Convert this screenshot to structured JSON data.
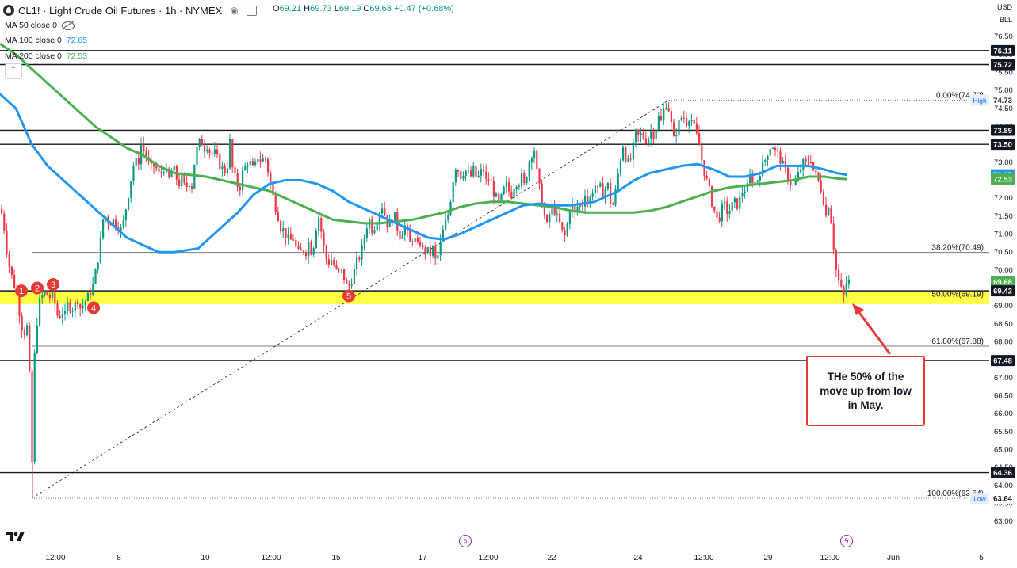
{
  "header": {
    "symbol_title": "CL1! · Light Crude Oil Futures · 1h · NYMEX",
    "open_label": "O",
    "open": "69.21",
    "high_label": "H",
    "high": "69.73",
    "low_label": "L",
    "low": "69.19",
    "close_label": "C",
    "close": "69.68",
    "change": "+0.47 (+0.68%)"
  },
  "indicators": [
    {
      "label": "MA 50 close 0",
      "value": "",
      "color": "#131722"
    },
    {
      "label": "MA 100 close 0",
      "value": "72.65",
      "color": "#2196f3"
    },
    {
      "label": "MA 200 close 0",
      "value": "72.53",
      "color": "#4caf50"
    }
  ],
  "top_right": {
    "currency": "USD",
    "unit": "BLL"
  },
  "annotation": {
    "text": "THe 50% of the move up from low in May."
  },
  "events": [
    {
      "icon": "forward-icon"
    },
    {
      "icon": "bolt-icon"
    }
  ],
  "colors": {
    "up": "#089981",
    "down": "#f23645",
    "ma100": "#2196f3",
    "ma200": "#4caf50",
    "highlight": "#ffff3b",
    "marker": "#e53935",
    "arrow": "#e53935"
  },
  "chart_data": {
    "type": "candlestick",
    "ylim": [
      62.6,
      77.4
    ],
    "y_ticks": [
      63.0,
      63.5,
      64.0,
      64.5,
      65.0,
      65.5,
      66.0,
      66.5,
      67.0,
      67.5,
      68.0,
      68.5,
      69.0,
      69.5,
      70.0,
      70.5,
      71.0,
      71.5,
      72.0,
      72.5,
      73.0,
      73.5,
      74.0,
      74.5,
      75.0,
      75.5,
      76.0,
      76.5
    ],
    "x_tick_labels": [
      "12:00",
      "8",
      "10",
      "12:00",
      "15",
      "17",
      "12:00",
      "22",
      "24",
      "12:00",
      "29",
      "12:00",
      "Jun",
      "5"
    ],
    "price_badges": [
      {
        "value": "76.11",
        "style": "black"
      },
      {
        "value": "75.72",
        "style": "black"
      },
      {
        "value": "74.73",
        "style": "gray",
        "tag": "High"
      },
      {
        "value": "73.89",
        "style": "black"
      },
      {
        "value": "73.50",
        "style": "black"
      },
      {
        "value": "72.65",
        "style": "blue"
      },
      {
        "value": "72.53",
        "style": "green"
      },
      {
        "value": "69.68",
        "style": "greenlast"
      },
      {
        "value": "69.42",
        "style": "black"
      },
      {
        "value": "67.48",
        "style": "black"
      },
      {
        "value": "64.36",
        "style": "black"
      },
      {
        "value": "63.64",
        "style": "gray",
        "tag": "Low"
      }
    ],
    "horizontal_lines": [
      76.11,
      75.72,
      73.89,
      73.5,
      69.42,
      67.48,
      64.36
    ],
    "fib_levels": [
      {
        "label": "0.00%(74.73)",
        "value": 74.73
      },
      {
        "label": "38.20%(70.49)",
        "value": 70.49
      },
      {
        "label": "50.00%(69.19)",
        "value": 69.19
      },
      {
        "label": "61.80%(67.88)",
        "value": 67.88
      },
      {
        "label": "100.00%(63.64)",
        "value": 63.64
      }
    ],
    "highlight_zone": [
      69.14,
      69.42
    ],
    "markers": [
      "1",
      "2",
      "3",
      "4",
      "5"
    ],
    "price_path": [
      [
        0,
        71.7
      ],
      [
        4,
        71.6
      ],
      [
        8,
        71.1
      ],
      [
        12,
        70.3
      ],
      [
        16,
        69.9
      ],
      [
        20,
        69.6
      ],
      [
        24,
        69.3
      ],
      [
        28,
        68.6
      ],
      [
        32,
        68.2
      ],
      [
        36,
        68.5
      ],
      [
        40,
        66.8
      ],
      [
        42,
        63.64
      ],
      [
        44,
        67.0
      ],
      [
        48,
        68.4
      ],
      [
        52,
        69.1
      ],
      [
        56,
        69.3
      ],
      [
        60,
        69.4
      ],
      [
        64,
        69.2
      ],
      [
        68,
        69.4
      ],
      [
        72,
        69.0
      ],
      [
        76,
        68.6
      ],
      [
        80,
        68.9
      ],
      [
        84,
        68.7
      ],
      [
        88,
        69.1
      ],
      [
        92,
        68.9
      ],
      [
        96,
        69.0
      ],
      [
        100,
        69.2
      ],
      [
        104,
        68.9
      ],
      [
        108,
        69.1
      ],
      [
        112,
        69.2
      ],
      [
        116,
        69.4
      ],
      [
        120,
        69.6
      ],
      [
        124,
        70.1
      ],
      [
        128,
        70.6
      ],
      [
        132,
        71.4
      ],
      [
        136,
        71.5
      ],
      [
        140,
        71.3
      ],
      [
        144,
        71.4
      ],
      [
        148,
        71.3
      ],
      [
        152,
        71.2
      ],
      [
        156,
        71.1
      ],
      [
        160,
        71.6
      ],
      [
        164,
        72.1
      ],
      [
        168,
        72.6
      ],
      [
        172,
        73.1
      ],
      [
        176,
        72.9
      ],
      [
        180,
        73.5
      ],
      [
        184,
        73.3
      ],
      [
        188,
        73.1
      ],
      [
        192,
        72.8
      ],
      [
        196,
        72.9
      ],
      [
        200,
        72.8
      ],
      [
        204,
        72.6
      ],
      [
        208,
        72.9
      ],
      [
        212,
        72.7
      ],
      [
        216,
        72.5
      ],
      [
        220,
        72.9
      ],
      [
        224,
        72.6
      ],
      [
        228,
        72.4
      ],
      [
        232,
        72.6
      ],
      [
        236,
        72.2
      ],
      [
        240,
        72.5
      ],
      [
        244,
        72.3
      ],
      [
        248,
        73.1
      ],
      [
        252,
        73.5
      ],
      [
        256,
        73.6
      ],
      [
        260,
        73.4
      ],
      [
        264,
        73.5
      ],
      [
        268,
        73.2
      ],
      [
        272,
        73.3
      ],
      [
        276,
        73.1
      ],
      [
        280,
        72.9
      ],
      [
        284,
        72.8
      ],
      [
        288,
        72.7
      ],
      [
        292,
        73.6
      ],
      [
        296,
        72.7
      ],
      [
        300,
        72.5
      ],
      [
        304,
        72.2
      ],
      [
        308,
        72.7
      ],
      [
        312,
        72.9
      ],
      [
        316,
        73.1
      ],
      [
        320,
        72.8
      ],
      [
        324,
        72.9
      ],
      [
        328,
        73.2
      ],
      [
        332,
        73.0
      ],
      [
        336,
        73.2
      ],
      [
        340,
        72.8
      ],
      [
        344,
        72.3
      ],
      [
        348,
        71.9
      ],
      [
        352,
        71.6
      ],
      [
        356,
        71.2
      ],
      [
        360,
        71.1
      ],
      [
        364,
        70.9
      ],
      [
        368,
        70.8
      ],
      [
        372,
        70.9
      ],
      [
        376,
        70.6
      ],
      [
        380,
        70.4
      ],
      [
        384,
        70.6
      ],
      [
        388,
        70.5
      ],
      [
        392,
        70.8
      ],
      [
        396,
        70.4
      ],
      [
        400,
        71.1
      ],
      [
        404,
        71.5
      ],
      [
        408,
        71.0
      ],
      [
        412,
        70.4
      ],
      [
        416,
        70.2
      ],
      [
        420,
        70.3
      ],
      [
        424,
        70.1
      ],
      [
        428,
        69.9
      ],
      [
        432,
        70.0
      ],
      [
        436,
        69.8
      ],
      [
        440,
        69.5
      ],
      [
        444,
        69.6
      ],
      [
        448,
        69.9
      ],
      [
        452,
        70.2
      ],
      [
        456,
        70.4
      ],
      [
        460,
        70.7
      ],
      [
        464,
        71.2
      ],
      [
        468,
        71.4
      ],
      [
        472,
        71.1
      ],
      [
        476,
        71.3
      ],
      [
        480,
        71.6
      ],
      [
        484,
        71.8
      ],
      [
        488,
        71.5
      ],
      [
        492,
        71.2
      ],
      [
        496,
        71.4
      ],
      [
        500,
        71.5
      ],
      [
        504,
        71.1
      ],
      [
        508,
        70.9
      ],
      [
        512,
        71.3
      ],
      [
        516,
        71.0
      ],
      [
        520,
        70.7
      ],
      [
        524,
        71.0
      ],
      [
        528,
        70.6
      ],
      [
        532,
        70.8
      ],
      [
        536,
        70.5
      ],
      [
        540,
        70.6
      ],
      [
        544,
        70.4
      ],
      [
        548,
        70.6
      ],
      [
        552,
        70.2
      ],
      [
        556,
        70.5
      ],
      [
        560,
        71.0
      ],
      [
        564,
        71.3
      ],
      [
        568,
        71.6
      ],
      [
        572,
        72.2
      ],
      [
        576,
        72.9
      ],
      [
        580,
        72.8
      ],
      [
        584,
        72.6
      ],
      [
        588,
        72.8
      ],
      [
        592,
        72.7
      ],
      [
        596,
        72.6
      ],
      [
        600,
        72.8
      ],
      [
        604,
        72.5
      ],
      [
        608,
        72.7
      ],
      [
        612,
        72.8
      ],
      [
        616,
        72.4
      ],
      [
        620,
        72.6
      ],
      [
        624,
        72.2
      ],
      [
        628,
        72.0
      ],
      [
        632,
        71.8
      ],
      [
        636,
        72.1
      ],
      [
        640,
        72.4
      ],
      [
        644,
        72.2
      ],
      [
        648,
        72.1
      ],
      [
        652,
        72.5
      ],
      [
        656,
        72.4
      ],
      [
        660,
        72.6
      ],
      [
        664,
        72.3
      ],
      [
        668,
        72.9
      ],
      [
        672,
        73.2
      ],
      [
        676,
        73.4
      ],
      [
        680,
        72.6
      ],
      [
        684,
        72.1
      ],
      [
        688,
        71.6
      ],
      [
        692,
        71.2
      ],
      [
        696,
        71.6
      ],
      [
        700,
        71.8
      ],
      [
        704,
        71.5
      ],
      [
        708,
        71.3
      ],
      [
        712,
        71.0
      ],
      [
        716,
        70.9
      ],
      [
        720,
        71.7
      ],
      [
        724,
        71.8
      ],
      [
        728,
        71.5
      ],
      [
        732,
        71.9
      ],
      [
        736,
        71.7
      ],
      [
        740,
        72.2
      ],
      [
        744,
        71.8
      ],
      [
        748,
        72.1
      ],
      [
        752,
        72.4
      ],
      [
        756,
        72.2
      ],
      [
        760,
        72.3
      ],
      [
        764,
        72.1
      ],
      [
        768,
        72.5
      ],
      [
        772,
        71.9
      ],
      [
        776,
        71.8
      ],
      [
        780,
        72.4
      ],
      [
        784,
        73.0
      ],
      [
        788,
        73.5
      ],
      [
        792,
        73.1
      ],
      [
        796,
        72.9
      ],
      [
        800,
        73.3
      ],
      [
        804,
        73.8
      ],
      [
        808,
        73.7
      ],
      [
        812,
        73.8
      ],
      [
        816,
        73.6
      ],
      [
        820,
        73.7
      ],
      [
        824,
        73.9
      ],
      [
        828,
        73.7
      ],
      [
        832,
        74.3
      ],
      [
        836,
        74.1
      ],
      [
        840,
        74.5
      ],
      [
        844,
        74.73
      ],
      [
        848,
        74.2
      ],
      [
        852,
        73.6
      ],
      [
        856,
        73.9
      ],
      [
        860,
        74.2
      ],
      [
        864,
        74.3
      ],
      [
        868,
        74.1
      ],
      [
        872,
        74.3
      ],
      [
        876,
        74.1
      ],
      [
        880,
        73.8
      ],
      [
        884,
        73.5
      ],
      [
        888,
        73.0
      ],
      [
        892,
        72.6
      ],
      [
        896,
        72.3
      ],
      [
        900,
        71.9
      ],
      [
        904,
        71.6
      ],
      [
        908,
        71.3
      ],
      [
        912,
        71.7
      ],
      [
        916,
        71.8
      ],
      [
        920,
        71.6
      ],
      [
        924,
        71.7
      ],
      [
        928,
        71.9
      ],
      [
        932,
        71.8
      ],
      [
        936,
        72.0
      ],
      [
        940,
        72.3
      ],
      [
        944,
        72.2
      ],
      [
        948,
        72.6
      ],
      [
        952,
        72.5
      ],
      [
        956,
        72.4
      ],
      [
        960,
        72.7
      ],
      [
        964,
        72.9
      ],
      [
        968,
        73.1
      ],
      [
        972,
        73.4
      ],
      [
        976,
        73.5
      ],
      [
        980,
        73.3
      ],
      [
        984,
        73.2
      ],
      [
        988,
        73.0
      ],
      [
        992,
        72.8
      ],
      [
        996,
        72.6
      ],
      [
        1000,
        72.4
      ],
      [
        1004,
        72.3
      ],
      [
        1008,
        72.6
      ],
      [
        1012,
        72.8
      ],
      [
        1016,
        73.0
      ],
      [
        1020,
        72.9
      ],
      [
        1024,
        73.2
      ],
      [
        1028,
        72.8
      ],
      [
        1032,
        72.6
      ],
      [
        1036,
        72.4
      ],
      [
        1040,
        72.1
      ],
      [
        1044,
        71.5
      ],
      [
        1048,
        71.9
      ],
      [
        1052,
        71.1
      ],
      [
        1056,
        70.1
      ],
      [
        1060,
        69.7
      ],
      [
        1064,
        69.4
      ],
      [
        1068,
        69.21
      ],
      [
        1070,
        69.68
      ]
    ],
    "ma100_path": [
      [
        0,
        74.9
      ],
      [
        20,
        74.5
      ],
      [
        40,
        73.5
      ],
      [
        60,
        72.9
      ],
      [
        80,
        72.5
      ],
      [
        100,
        72.1
      ],
      [
        120,
        71.7
      ],
      [
        140,
        71.3
      ],
      [
        160,
        70.9
      ],
      [
        180,
        70.7
      ],
      [
        200,
        70.5
      ],
      [
        220,
        70.5
      ],
      [
        250,
        70.6
      ],
      [
        280,
        71.2
      ],
      [
        300,
        71.6
      ],
      [
        320,
        72.1
      ],
      [
        340,
        72.4
      ],
      [
        360,
        72.5
      ],
      [
        380,
        72.5
      ],
      [
        400,
        72.4
      ],
      [
        420,
        72.2
      ],
      [
        440,
        71.9
      ],
      [
        460,
        71.7
      ],
      [
        480,
        71.5
      ],
      [
        500,
        71.3
      ],
      [
        520,
        71.1
      ],
      [
        540,
        70.9
      ],
      [
        560,
        70.85
      ],
      [
        580,
        71.0
      ],
      [
        600,
        71.2
      ],
      [
        620,
        71.4
      ],
      [
        640,
        71.6
      ],
      [
        660,
        71.8
      ],
      [
        680,
        71.85
      ],
      [
        700,
        71.8
      ],
      [
        720,
        71.8
      ],
      [
        750,
        71.9
      ],
      [
        780,
        72.2
      ],
      [
        800,
        72.5
      ],
      [
        820,
        72.7
      ],
      [
        840,
        72.8
      ],
      [
        860,
        72.9
      ],
      [
        880,
        72.95
      ],
      [
        900,
        72.8
      ],
      [
        920,
        72.6
      ],
      [
        940,
        72.6
      ],
      [
        960,
        72.7
      ],
      [
        980,
        72.9
      ],
      [
        1000,
        72.9
      ],
      [
        1020,
        72.9
      ],
      [
        1040,
        72.8
      ],
      [
        1055,
        72.7
      ],
      [
        1068,
        72.65
      ]
    ],
    "ma200_path": [
      [
        0,
        76.3
      ],
      [
        20,
        76.0
      ],
      [
        40,
        75.6
      ],
      [
        60,
        75.2
      ],
      [
        80,
        74.8
      ],
      [
        100,
        74.4
      ],
      [
        120,
        74.0
      ],
      [
        140,
        73.7
      ],
      [
        160,
        73.4
      ],
      [
        180,
        73.2
      ],
      [
        200,
        72.9
      ],
      [
        220,
        72.7
      ],
      [
        240,
        72.65
      ],
      [
        260,
        72.6
      ],
      [
        280,
        72.5
      ],
      [
        300,
        72.4
      ],
      [
        320,
        72.3
      ],
      [
        340,
        72.2
      ],
      [
        360,
        72.0
      ],
      [
        380,
        71.8
      ],
      [
        400,
        71.6
      ],
      [
        420,
        71.4
      ],
      [
        440,
        71.35
      ],
      [
        460,
        71.3
      ],
      [
        480,
        71.3
      ],
      [
        500,
        71.35
      ],
      [
        520,
        71.4
      ],
      [
        540,
        71.5
      ],
      [
        560,
        71.6
      ],
      [
        580,
        71.75
      ],
      [
        600,
        71.85
      ],
      [
        620,
        71.9
      ],
      [
        640,
        71.9
      ],
      [
        660,
        71.85
      ],
      [
        680,
        71.8
      ],
      [
        700,
        71.75
      ],
      [
        720,
        71.65
      ],
      [
        740,
        71.6
      ],
      [
        760,
        71.6
      ],
      [
        780,
        71.6
      ],
      [
        800,
        71.6
      ],
      [
        820,
        71.65
      ],
      [
        840,
        71.75
      ],
      [
        860,
        71.9
      ],
      [
        880,
        72.05
      ],
      [
        900,
        72.2
      ],
      [
        920,
        72.3
      ],
      [
        940,
        72.35
      ],
      [
        960,
        72.4
      ],
      [
        980,
        72.45
      ],
      [
        1000,
        72.5
      ],
      [
        1020,
        72.6
      ],
      [
        1040,
        72.6
      ],
      [
        1055,
        72.55
      ],
      [
        1068,
        72.53
      ]
    ],
    "trendline": [
      [
        40,
        63.64
      ],
      [
        844,
        74.73
      ]
    ]
  }
}
